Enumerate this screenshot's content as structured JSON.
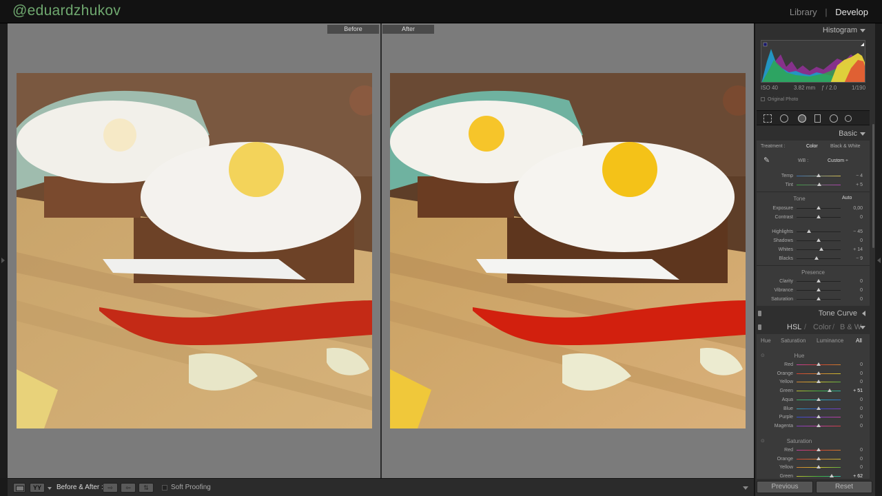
{
  "watermark": "@eduardzhukov",
  "modules": {
    "library": "Library",
    "separator": "|",
    "develop": "Develop"
  },
  "view": {
    "before_label": "Before",
    "after_label": "After"
  },
  "toolbar": {
    "view_mode": "YY",
    "before_after_label": "Before & After :",
    "soft_proofing_label": "Soft Proofing"
  },
  "histogram": {
    "title": "Histogram",
    "iso": "ISO 40",
    "focal": "3.82 mm",
    "aperture": "ƒ / 2.0",
    "shutter": "1/190",
    "original_photo": "Original Photo"
  },
  "basic": {
    "title": "Basic",
    "treatment_label": "Treatment :",
    "treatment_color": "Color",
    "treatment_bw": "Black & White",
    "wb_label": "WB :",
    "wb_value": "Custom ÷",
    "temp": {
      "label": "Temp",
      "value": "− 4",
      "pos": 0.5
    },
    "tint": {
      "label": "Tint",
      "value": "+ 5",
      "pos": 0.52
    },
    "tone_label": "Tone",
    "auto_label": "Auto",
    "exposure": {
      "label": "Exposure",
      "value": "0,00",
      "pos": 0.5
    },
    "contrast": {
      "label": "Contrast",
      "value": "0",
      "pos": 0.5
    },
    "highlights": {
      "label": "Highlights",
      "value": "− 45",
      "pos": 0.28
    },
    "shadows": {
      "label": "Shadows",
      "value": "0",
      "pos": 0.5
    },
    "whites": {
      "label": "Whites",
      "value": "+ 14",
      "pos": 0.57
    },
    "blacks": {
      "label": "Blacks",
      "value": "− 9",
      "pos": 0.46
    },
    "presence_label": "Presence",
    "clarity": {
      "label": "Clarity",
      "value": "0",
      "pos": 0.5
    },
    "vibrance": {
      "label": "Vibrance",
      "value": "0",
      "pos": 0.5
    },
    "saturation": {
      "label": "Saturation",
      "value": "0",
      "pos": 0.5
    }
  },
  "tone_curve": {
    "title": "Tone Curve"
  },
  "hsl": {
    "title_hsl": "HSL",
    "title_color": "Color",
    "title_bw": "B & W",
    "sep": "/",
    "tabs": [
      "Hue",
      "Saturation",
      "Luminance",
      "All"
    ],
    "hue_label": "Hue",
    "hue": [
      {
        "label": "Red",
        "value": "0",
        "pos": 0.5
      },
      {
        "label": "Orange",
        "value": "0",
        "pos": 0.5
      },
      {
        "label": "Yellow",
        "value": "0",
        "pos": 0.5
      },
      {
        "label": "Green",
        "value": "+ 51",
        "pos": 0.75
      },
      {
        "label": "Aqua",
        "value": "0",
        "pos": 0.5
      },
      {
        "label": "Blue",
        "value": "0",
        "pos": 0.5
      },
      {
        "label": "Purple",
        "value": "0",
        "pos": 0.5
      },
      {
        "label": "Magenta",
        "value": "0",
        "pos": 0.5
      }
    ],
    "saturation_label": "Saturation",
    "saturation": [
      {
        "label": "Red",
        "value": "0",
        "pos": 0.5
      },
      {
        "label": "Orange",
        "value": "0",
        "pos": 0.5
      },
      {
        "label": "Yellow",
        "value": "0",
        "pos": 0.5
      },
      {
        "label": "Green",
        "value": "+ 62",
        "pos": 0.8
      }
    ]
  },
  "buttons": {
    "previous": "Previous",
    "reset": "Reset"
  }
}
